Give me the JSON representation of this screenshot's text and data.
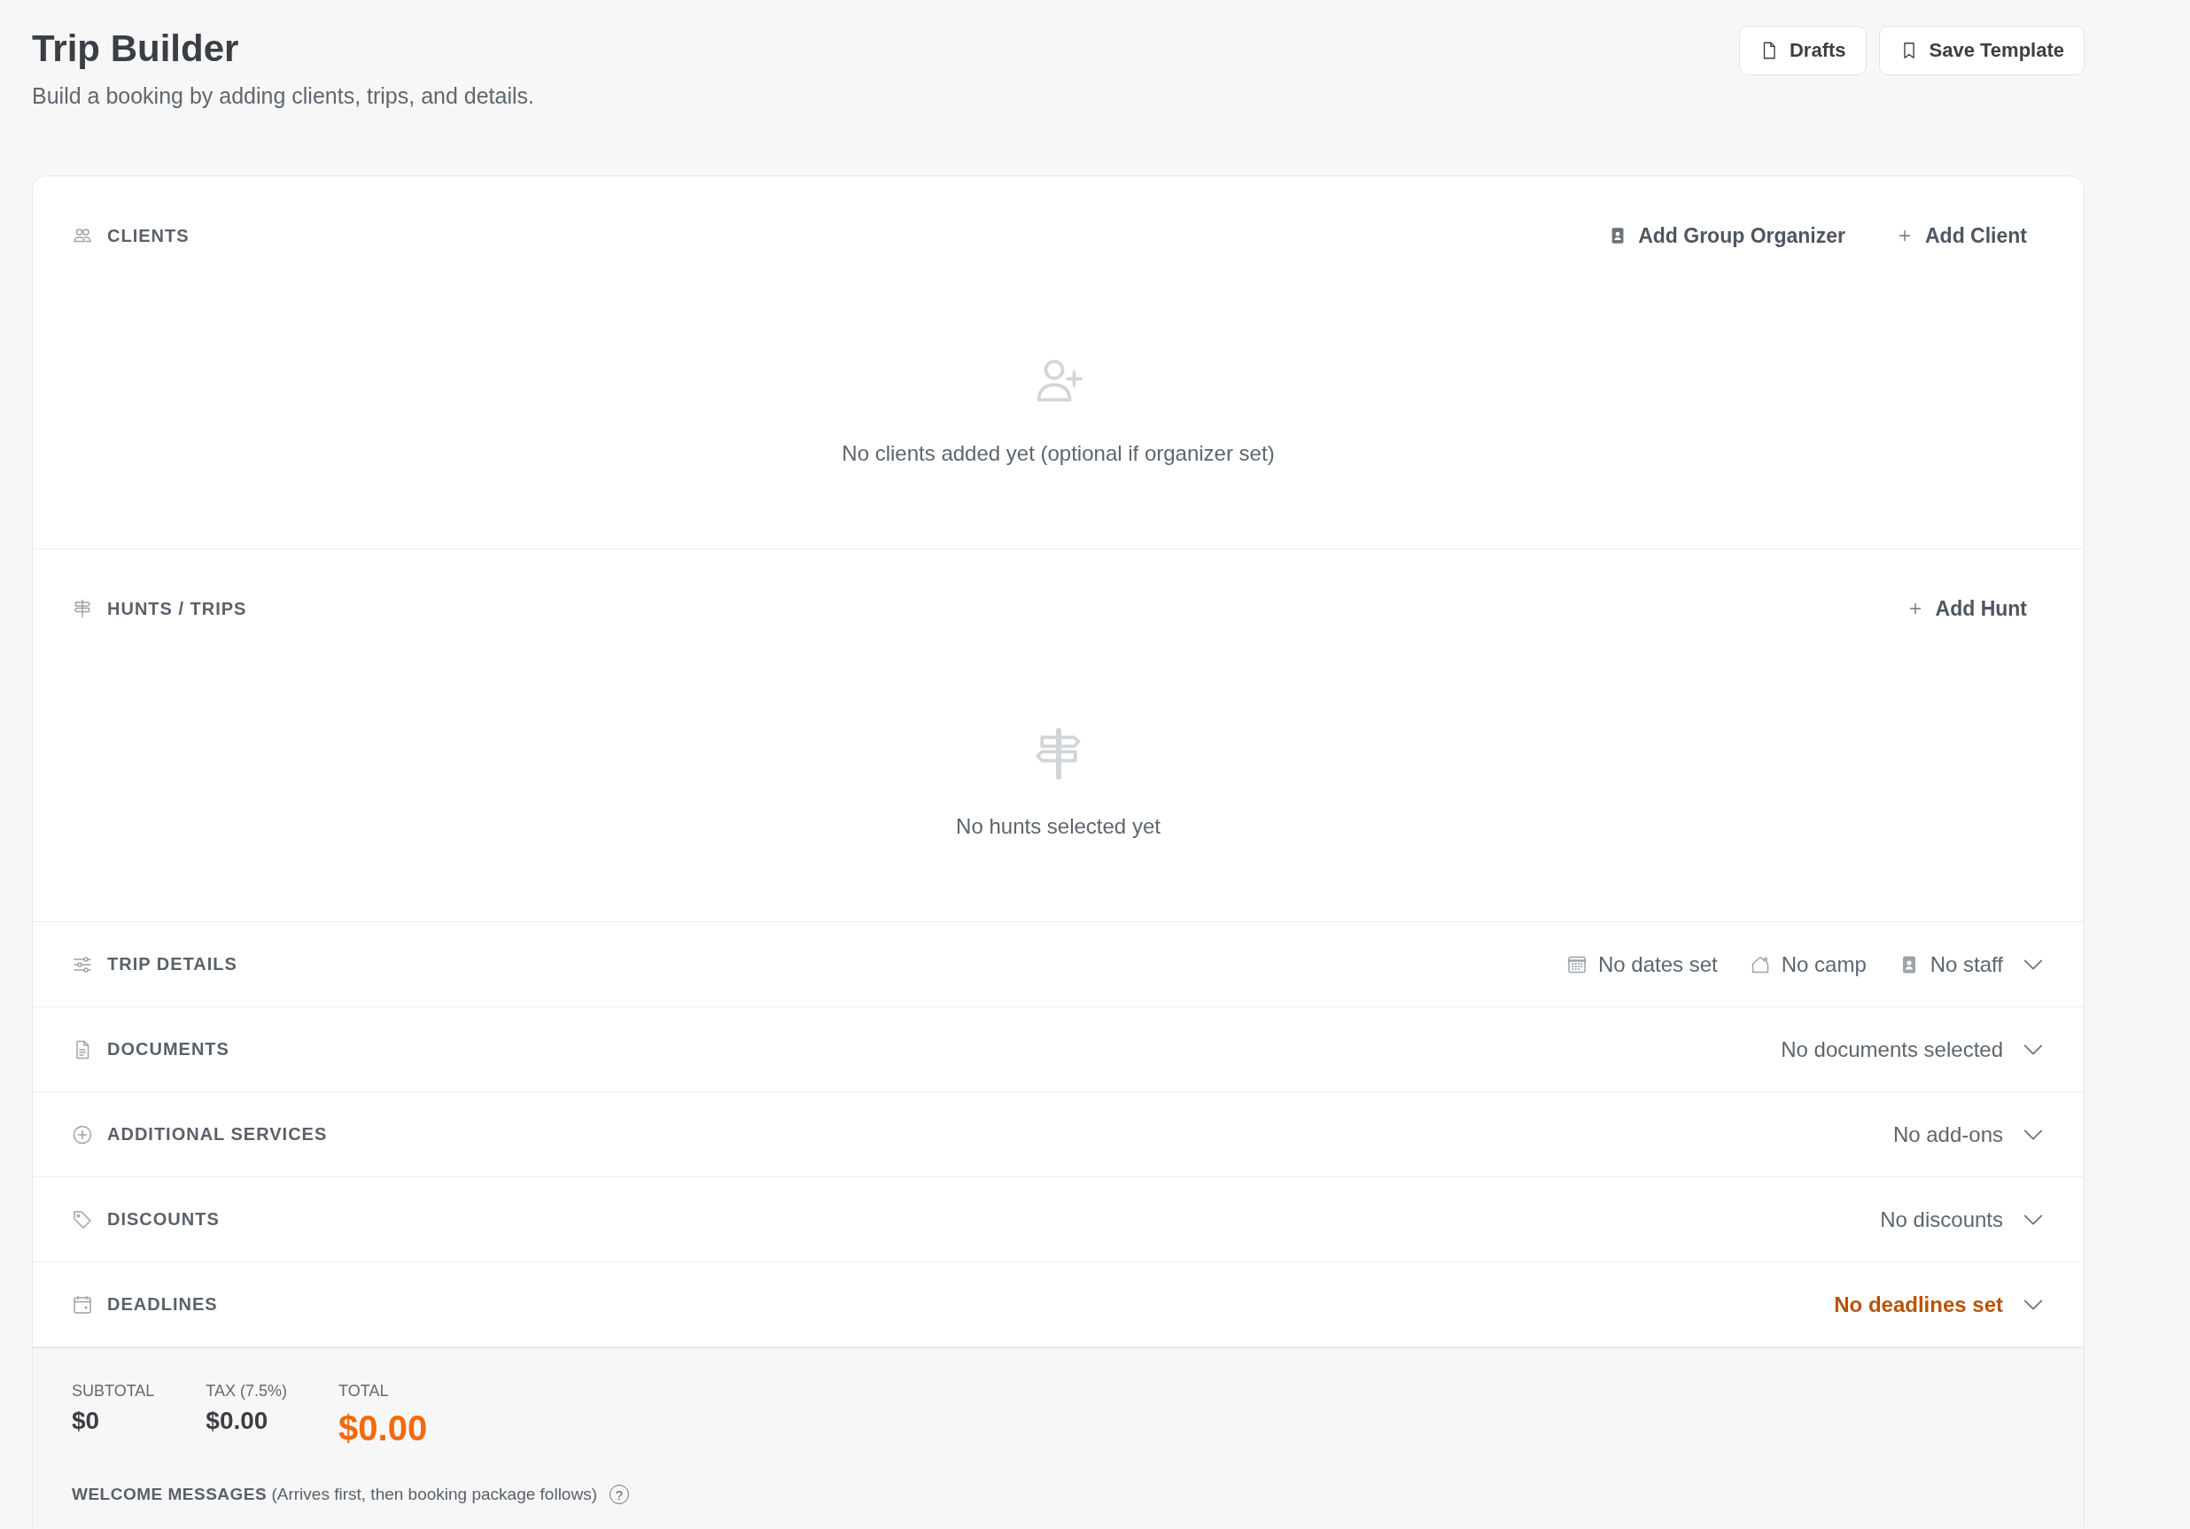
{
  "header": {
    "title": "Trip Builder",
    "subtitle": "Build a booking by adding clients, trips, and details.",
    "buttons": [
      {
        "kind": "drafts",
        "label": "Drafts"
      },
      {
        "kind": "template",
        "label": "Save Template"
      }
    ]
  },
  "sections": [
    {
      "kind": "clients",
      "title": "CLIENTS",
      "actions": [
        {
          "kind": "organizer",
          "label": "Add Group Organizer"
        },
        {
          "kind": "add",
          "label": "Add Client"
        }
      ],
      "empty": "No clients added yet (optional if organizer set)"
    },
    {
      "kind": "hunts",
      "title": "HUNTS / TRIPS",
      "actions": [
        {
          "kind": "add",
          "label": "Add Hunt"
        }
      ],
      "empty": "No hunts selected yet"
    },
    {
      "kind": "details",
      "title": "TRIP DETAILS",
      "alert": false,
      "summary": [
        {
          "kind": "dates",
          "text": "No dates set"
        },
        {
          "kind": "camp",
          "text": "No camp"
        },
        {
          "kind": "staff",
          "text": "No staff"
        }
      ]
    },
    {
      "kind": "documents",
      "title": "DOCUMENTS",
      "alert": false,
      "summary": [
        {
          "kind": "plain",
          "text": "No documents selected"
        }
      ]
    },
    {
      "kind": "services",
      "title": "ADDITIONAL SERVICES",
      "alert": false,
      "summary": [
        {
          "kind": "plain",
          "text": "No add-ons"
        }
      ]
    },
    {
      "kind": "discounts",
      "title": "DISCOUNTS",
      "alert": false,
      "summary": [
        {
          "kind": "plain",
          "text": "No discounts"
        }
      ]
    },
    {
      "kind": "deadlines",
      "title": "DEADLINES",
      "alert": true,
      "summary": [
        {
          "kind": "plain",
          "text": "No deadlines set"
        }
      ]
    }
  ],
  "totals": [
    {
      "kind": "amount",
      "label": "SUBTOTAL",
      "value": "$0"
    },
    {
      "kind": "amount",
      "label": "TAX (7.5%)",
      "value": "$0.00"
    },
    {
      "kind": "total",
      "label": "TOTAL",
      "value": "$0.00"
    }
  ],
  "welcome": {
    "label": "WELCOME MESSAGES",
    "note": "(Arrives first, then booking package follows)",
    "help": "?"
  }
}
